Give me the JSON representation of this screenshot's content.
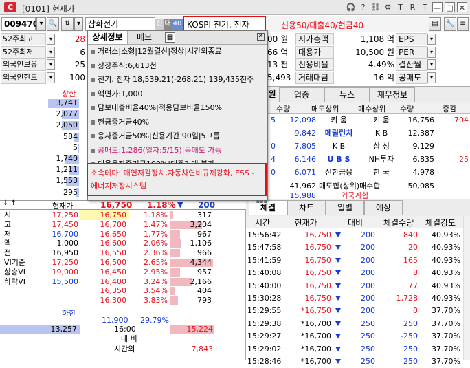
{
  "window": {
    "title": "[0101] 현재가",
    "logo": "C",
    "icons": [
      "headset-icon",
      "help-icon",
      "link-icon",
      "settings-icon",
      "pin-icon",
      "r-icon",
      "text-size-icon",
      "minimize-icon",
      "maximize-icon",
      "close-icon"
    ],
    "icon_glyphs": [
      "🎧",
      "?",
      "⛓",
      "⚙",
      "T",
      "R",
      "T",
      "—",
      "□",
      "✕"
    ]
  },
  "toolbar": {
    "code": "009470",
    "stock_name": "삼화전기",
    "tag1": "신",
    "tag2": "대",
    "tag3": "40",
    "sector": "KOSPI 전기. 전자",
    "credit": "신용50/대출40/현금40"
  },
  "left_stats": [
    {
      "label": "52주최고",
      "value": "28"
    },
    {
      "label": "52주최저",
      "value": "6"
    },
    {
      "label": "외국인보유",
      "value": "25"
    },
    {
      "label": "외국인한도",
      "value": "100"
    }
  ],
  "mid_stats": [
    "00 원",
    "66 억",
    "13 천",
    "5,493"
  ],
  "right_stats": [
    {
      "label": "시가총액",
      "value": "1,108 억",
      "label2": "EPS"
    },
    {
      "label": "대용가",
      "value": "10,500 원",
      "label2": "PER"
    },
    {
      "label": "신용비율",
      "value": "4.49%",
      "label2": "결산월"
    },
    {
      "label": "거래대금",
      "value": "16 억",
      "label2": "공매도"
    }
  ],
  "popup": {
    "tab_active": "상세정보",
    "tab_other": "메모",
    "lines": [
      "거래소|소형|12월결산|정상|시간외종료",
      "상장주식:6,613천",
      "전기. 전자 18,539.21(-268.21) 139,435천주",
      "액면가:1,000",
      "담보대출비율40%|적용담보비율150%",
      "현금증거금40%",
      "응자증거금50%|신용기간 90일|5그룹",
      "공매도:1,286(일자:5/15)|공매도 가능",
      "대용응자증거금100%|대주거래 불가"
    ],
    "theme": "소속테마: 매연저감장치,자동차연비규제강화, ESS - 에너지저장시스템"
  },
  "orderbook": {
    "upper_label": "상한",
    "lower_label": "하한",
    "ask_qty": [
      "3,741",
      "2,077",
      "2,050",
      "584",
      "5",
      "1,740",
      "1,211",
      "1,553",
      "295",
      "1"
    ],
    "ask_bar": [
      0.75,
      0.42,
      0.41,
      0.12,
      0.01,
      0.35,
      0.24,
      0.31,
      0.06,
      0.0
    ],
    "bid_qty": [
      "317",
      "3,204",
      "967",
      "1,106",
      "966",
      "4,344",
      "957",
      "2,166",
      "404",
      "793"
    ],
    "bid_bar": [
      0.07,
      0.74,
      0.22,
      0.25,
      0.22,
      1.0,
      0.22,
      0.5,
      0.09,
      0.18
    ],
    "prices": [
      "16,750",
      "16,700",
      "16,650",
      "16,600",
      "16,550",
      "16,500",
      "16,450",
      "16,400",
      "16,350",
      "16,300"
    ],
    "rates": [
      "1.18%",
      "1.47%",
      "1.77%",
      "2.06%",
      "2.36%",
      "2.65%",
      "2.95%",
      "3.24%",
      "3.54%",
      "3.83%"
    ],
    "header": {
      "label": "현재가",
      "price": "16,750",
      "rate": "1.18%",
      "change": "200"
    },
    "info_labels": [
      "시",
      "고",
      "저",
      "액",
      "전",
      "VI기준",
      "상승VI",
      "하락VI"
    ],
    "info_values": [
      "17,250",
      "17,450",
      "16,700",
      "1,000",
      "16,950",
      "17,250",
      "19,000",
      "15,500"
    ],
    "lower_price": "11,900",
    "lower_rate": "29.79%",
    "total_ask": "13,257",
    "total_time": "16:00",
    "total_bid": "15,224",
    "compare_label": "대 비",
    "after_label": "시간외",
    "after_value": "7,843"
  },
  "broker": {
    "tabs": [
      "원",
      "업종",
      "뉴스",
      "재무정보"
    ],
    "headers": [
      "수량",
      "매도상위",
      "매수상위",
      "수량",
      "증감"
    ],
    "rows": [
      {
        "sq": "12,098",
        "s": "키 움",
        "b": "키 움",
        "bq": "16,756",
        "d": "704"
      },
      {
        "sq": "9,842",
        "s": "메릴린치",
        "b": "K B",
        "bq": "12,387",
        "d": ""
      },
      {
        "sq": "7,805",
        "s": "K B",
        "b": "삼 성",
        "bq": "9,129",
        "d": ""
      },
      {
        "sq": "6,146",
        "s": "U B S",
        "b": "NH투자",
        "bq": "6,835",
        "d": "25"
      },
      {
        "sq": "6,071",
        "s": "신한금융",
        "b": "한 국",
        "bq": "4,978",
        "d": ""
      }
    ],
    "left_marks": [
      "5",
      "",
      "0",
      "4",
      "0"
    ],
    "summary": {
      "sell": "41,962",
      "label": "매도합(상위)매수합",
      "buy": "50,085"
    },
    "foreign": {
      "qty": "15,988",
      "label": "외국계합"
    }
  },
  "ticks": {
    "tabs": [
      "체결",
      "차트",
      "일별",
      "예상"
    ],
    "headers": [
      "시간",
      "현재가",
      "대비",
      "체결수량",
      "체결강도"
    ],
    "rows": [
      {
        "t": "15:56:42",
        "p": "16,750",
        "c": "200",
        "q": "840",
        "s": "40.93%",
        "up": true
      },
      {
        "t": "15:47:58",
        "p": "16,750",
        "c": "200",
        "q": "20",
        "s": "40.93%",
        "up": true
      },
      {
        "t": "15:41:59",
        "p": "16,750",
        "c": "200",
        "q": "165",
        "s": "40.93%",
        "up": true
      },
      {
        "t": "15:40:08",
        "p": "16,750",
        "c": "200",
        "q": "8",
        "s": "40.93%",
        "up": true
      },
      {
        "t": "15:40:00",
        "p": "16,750",
        "c": "200",
        "q": "77",
        "s": "40.93%",
        "up": true
      },
      {
        "t": "15:30:28",
        "p": "16,750",
        "c": "200",
        "q": "1,728",
        "s": "40.93%",
        "up": true
      },
      {
        "t": "15:29:55",
        "p": "*16,750",
        "c": "200",
        "q": "0",
        "s": "37.70%",
        "up": true
      },
      {
        "t": "15:29:38",
        "p": "*16,700",
        "c": "250",
        "q": "250",
        "s": "37.70%",
        "up": false
      },
      {
        "t": "15:29:27",
        "p": "*16,700",
        "c": "250",
        "q": "-250",
        "s": "37.70%",
        "up": false
      },
      {
        "t": "15:29:02",
        "p": "*16,700",
        "c": "250",
        "q": "250",
        "s": "37.70%",
        "up": false
      },
      {
        "t": "15:28:46",
        "p": "*16,700",
        "c": "250",
        "q": "250",
        "s": "37.70%",
        "up": false
      }
    ]
  }
}
